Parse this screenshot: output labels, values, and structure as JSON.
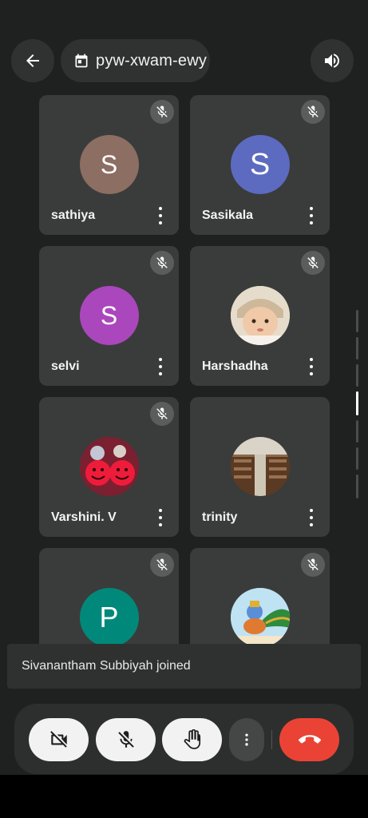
{
  "header": {
    "meeting_code": "pyw-xwam-ewy",
    "back_icon": "arrow-left-icon",
    "calendar_icon": "calendar-icon",
    "speaker_icon": "volume-icon"
  },
  "participants": [
    {
      "name": "sathiya",
      "initial": "S",
      "avatar_color": "#8d6e63",
      "muted": true
    },
    {
      "name": "Sasikala",
      "initial": "S",
      "avatar_color": "#5c6bc0",
      "muted": true
    },
    {
      "name": "selvi",
      "initial": "S",
      "avatar_color": "#ab47bc",
      "muted": true
    },
    {
      "name": "Harshadha",
      "initial": "",
      "avatar_color": "#d7c3a8",
      "muted": true
    },
    {
      "name": "Varshini. V",
      "initial": "",
      "avatar_color": "#a01c2c",
      "muted": true
    },
    {
      "name": "trinity",
      "initial": "",
      "avatar_color": "#6b4a2e",
      "muted": true
    },
    {
      "name": "",
      "initial": "P",
      "avatar_color": "#00897b",
      "muted": true
    },
    {
      "name": "",
      "initial": "",
      "avatar_color": "#7fb7d6",
      "muted": true
    }
  ],
  "toast": {
    "message": "Sivanantham Subbiyah joined"
  },
  "controls": {
    "camera_icon": "camera-off-icon",
    "mic_icon": "mic-off-icon",
    "hand_icon": "raise-hand-icon",
    "more_icon": "more-vertical-icon",
    "hangup_icon": "hang-up-icon",
    "hangup_color": "#ea4335"
  }
}
